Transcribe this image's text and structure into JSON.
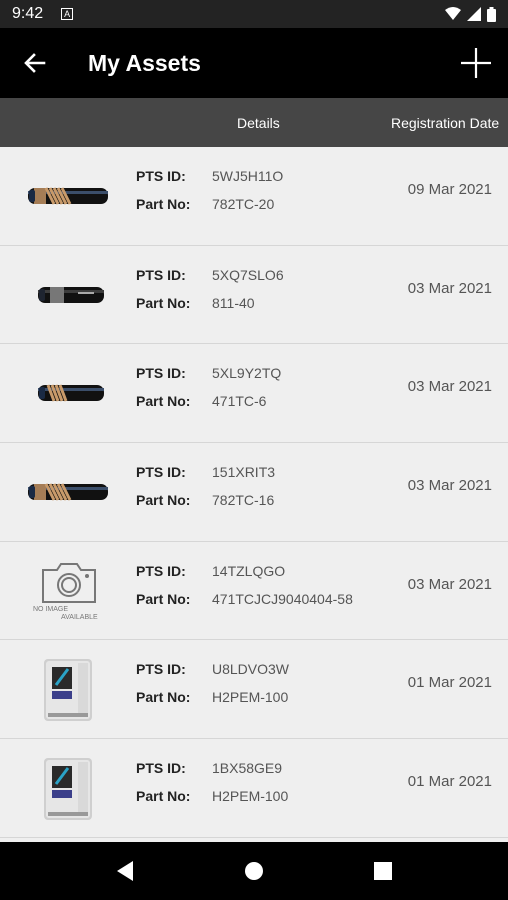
{
  "status_bar": {
    "time": "9:42",
    "notif_icon": "A"
  },
  "app_bar": {
    "title": "My Assets"
  },
  "columns": {
    "details": "Details",
    "registration_date": "Registration Date"
  },
  "labels": {
    "pts_id": "PTS ID:",
    "part_no": "Part No:"
  },
  "no_image": {
    "line1": "NO IMAGE",
    "line2": "AVAILABLE"
  },
  "assets": [
    {
      "thumb": "hose-long",
      "pts_id": "5WJ5H11O",
      "part_no": "782TC-20",
      "date": "09 Mar 2021"
    },
    {
      "thumb": "hose-short",
      "pts_id": "5XQ7SLO6",
      "part_no": "811-40",
      "date": "03 Mar 2021"
    },
    {
      "thumb": "hose-short-braided",
      "pts_id": "5XL9Y2TQ",
      "part_no": "471TC-6",
      "date": "03 Mar 2021"
    },
    {
      "thumb": "hose-long",
      "pts_id": "151XRIT3",
      "part_no": "782TC-16",
      "date": "03 Mar 2021"
    },
    {
      "thumb": "no-image",
      "pts_id": "14TZLQGO",
      "part_no": "471TCJCJ9040404-58",
      "date": "03 Mar 2021"
    },
    {
      "thumb": "machine",
      "pts_id": "U8LDVO3W",
      "part_no": "H2PEM-100",
      "date": "01 Mar 2021"
    },
    {
      "thumb": "machine",
      "pts_id": "1BX58GE9",
      "part_no": "H2PEM-100",
      "date": "01 Mar 2021"
    }
  ]
}
